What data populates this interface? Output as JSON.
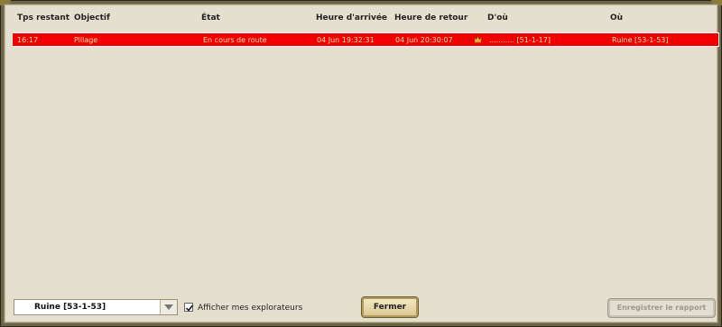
{
  "table": {
    "headers": [
      "Tps restant",
      "Objectif",
      "État",
      "Heure d'arrivée",
      "Heure de retour",
      "D'où",
      "Où"
    ],
    "rows": [
      {
        "remaining": "16:17",
        "objective": "Pillage",
        "state": "En cours de route",
        "arrival": "04 Jun 19:32:31",
        "return": "04 Jun 20:30:07",
        "from": "........... [51-1-17]",
        "to": "Ruine [53-1-53]",
        "from_icon": "crown-icon"
      }
    ]
  },
  "controls": {
    "location_select": "Ruine [53-1-53]",
    "checkbox_label": "Afficher mes explorateurs",
    "checkbox_checked": true,
    "close_button": "Fermer",
    "save_report_button": "Enregistrer le rapport"
  },
  "colors": {
    "row_highlight": "#f00000",
    "panel_background": "#e5dfcf",
    "frame": "#6e6548"
  }
}
